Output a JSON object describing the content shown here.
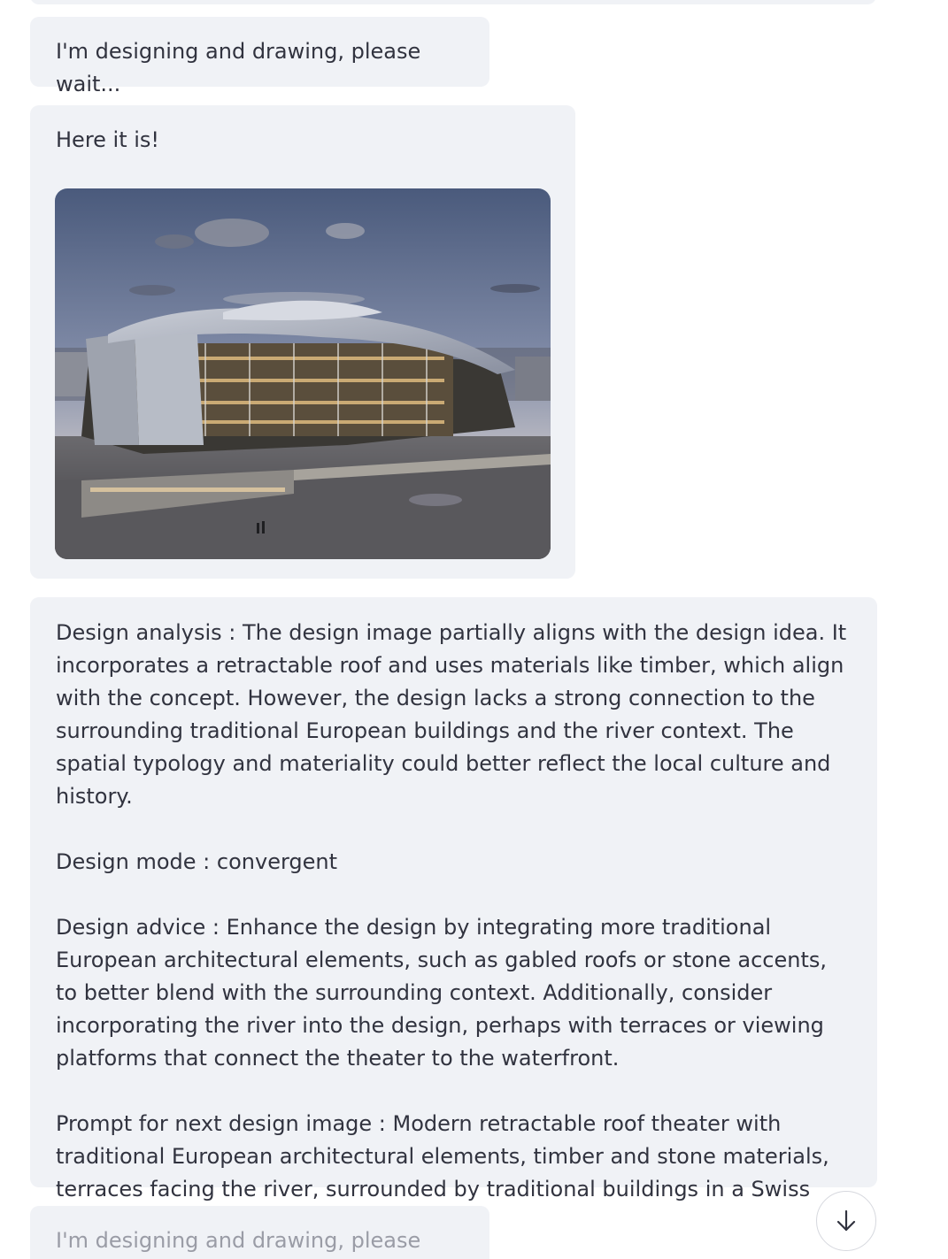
{
  "messages": [
    {
      "text": "I'm designing and drawing, please wait..."
    },
    {
      "text": "Here it is!",
      "image_alt": "architectural rendering"
    },
    {
      "analysis": "Design analysis : The design image partially aligns with the design idea. It incorporates a retractable roof and uses materials like timber, which align with the concept. However, the design lacks a strong connection to the surrounding traditional European buildings and the river context. The spatial typology and materiality could better reflect the local culture and history.",
      "mode": "Design mode : convergent",
      "advice": "Design advice : Enhance the design by integrating more traditional European architectural elements, such as gabled roofs or stone accents, to better blend with the surrounding context. Additionally, consider incorporating the river into the design, perhaps with terraces or viewing platforms that connect the theater to the waterfront.",
      "prompt": "Prompt for next design image : Modern retractable roof theater with traditional European architectural elements, timber and stone materials, terraces facing the river, surrounded by traditional buildings in a Swiss city."
    },
    {
      "text": "I'm designing and drawing, please wait..."
    }
  ],
  "scroll_button": {
    "icon": "arrow-down-icon"
  },
  "colors": {
    "bubble_bg": "#f0f2f6",
    "text": "#31333f",
    "faded_text": "#9a9ca6"
  }
}
